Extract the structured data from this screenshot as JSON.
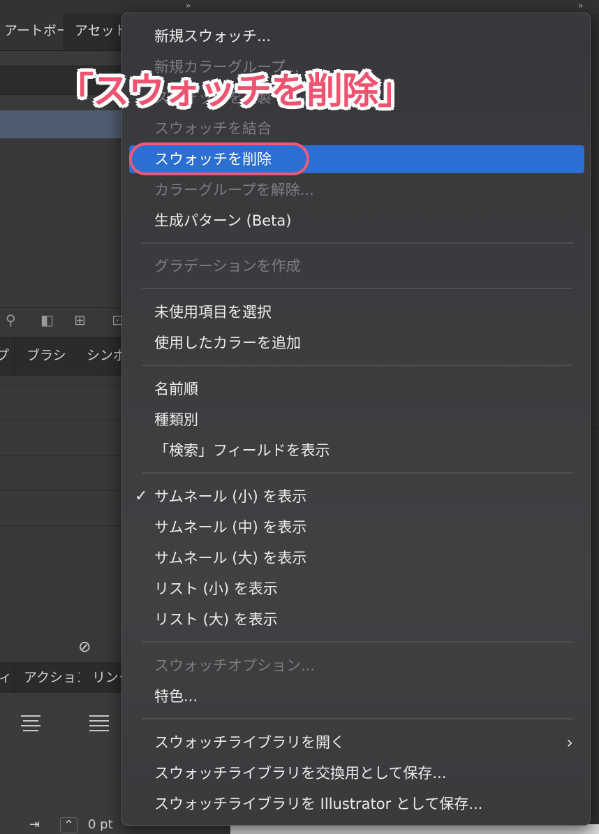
{
  "background": {
    "tabs_top": [
      "アートボード",
      "アセット"
    ],
    "tabs_middle": [
      "プ",
      "ブラシ",
      "シンボル"
    ],
    "tabs_lower": [
      "ィ",
      "アクション",
      "リンク"
    ],
    "bottom_value": "0 pt"
  },
  "menu": {
    "items": [
      {
        "label": "新規スウォッチ...",
        "enabled": true
      },
      {
        "label": "新規カラーグループ...",
        "enabled": false
      },
      {
        "label": "スウォッチを複製",
        "enabled": false
      },
      {
        "label": "スウォッチを結合",
        "enabled": false
      },
      {
        "label": "スウォッチを削除",
        "enabled": true,
        "highlighted": true
      },
      {
        "label": "カラーグループを解除...",
        "enabled": false
      },
      {
        "label": "生成パターン (Beta)",
        "enabled": true
      },
      {
        "label": "グラデーションを作成",
        "enabled": false
      },
      {
        "label": "未使用項目を選択",
        "enabled": true
      },
      {
        "label": "使用したカラーを追加",
        "enabled": true
      },
      {
        "label": "名前順",
        "enabled": true
      },
      {
        "label": "種類別",
        "enabled": true
      },
      {
        "label": "「検索」フィールドを表示",
        "enabled": true
      },
      {
        "label": "サムネール (小) を表示",
        "enabled": true,
        "checked": true
      },
      {
        "label": "サムネール (中) を表示",
        "enabled": true
      },
      {
        "label": "サムネール (大) を表示",
        "enabled": true
      },
      {
        "label": "リスト (小) を表示",
        "enabled": true
      },
      {
        "label": "リスト (大) を表示",
        "enabled": true
      },
      {
        "label": "スウォッチオプション...",
        "enabled": false
      },
      {
        "label": "特色...",
        "enabled": true
      },
      {
        "label": "スウォッチライブラリを開く",
        "enabled": true,
        "submenu": true
      },
      {
        "label": "スウォッチライブラリを交換用として保存...",
        "enabled": true
      },
      {
        "label": "スウォッチライブラリを Illustrator として保存...",
        "enabled": true
      }
    ],
    "check_glyph": "✓",
    "submenu_glyph": "›"
  },
  "annotation": {
    "label": "「スウォッチを削除」",
    "color": "#ee5470"
  },
  "colors": {
    "highlight": "#2c6fd3",
    "menu_bg": "#3a393c",
    "disabled_text": "#7d7d80"
  }
}
